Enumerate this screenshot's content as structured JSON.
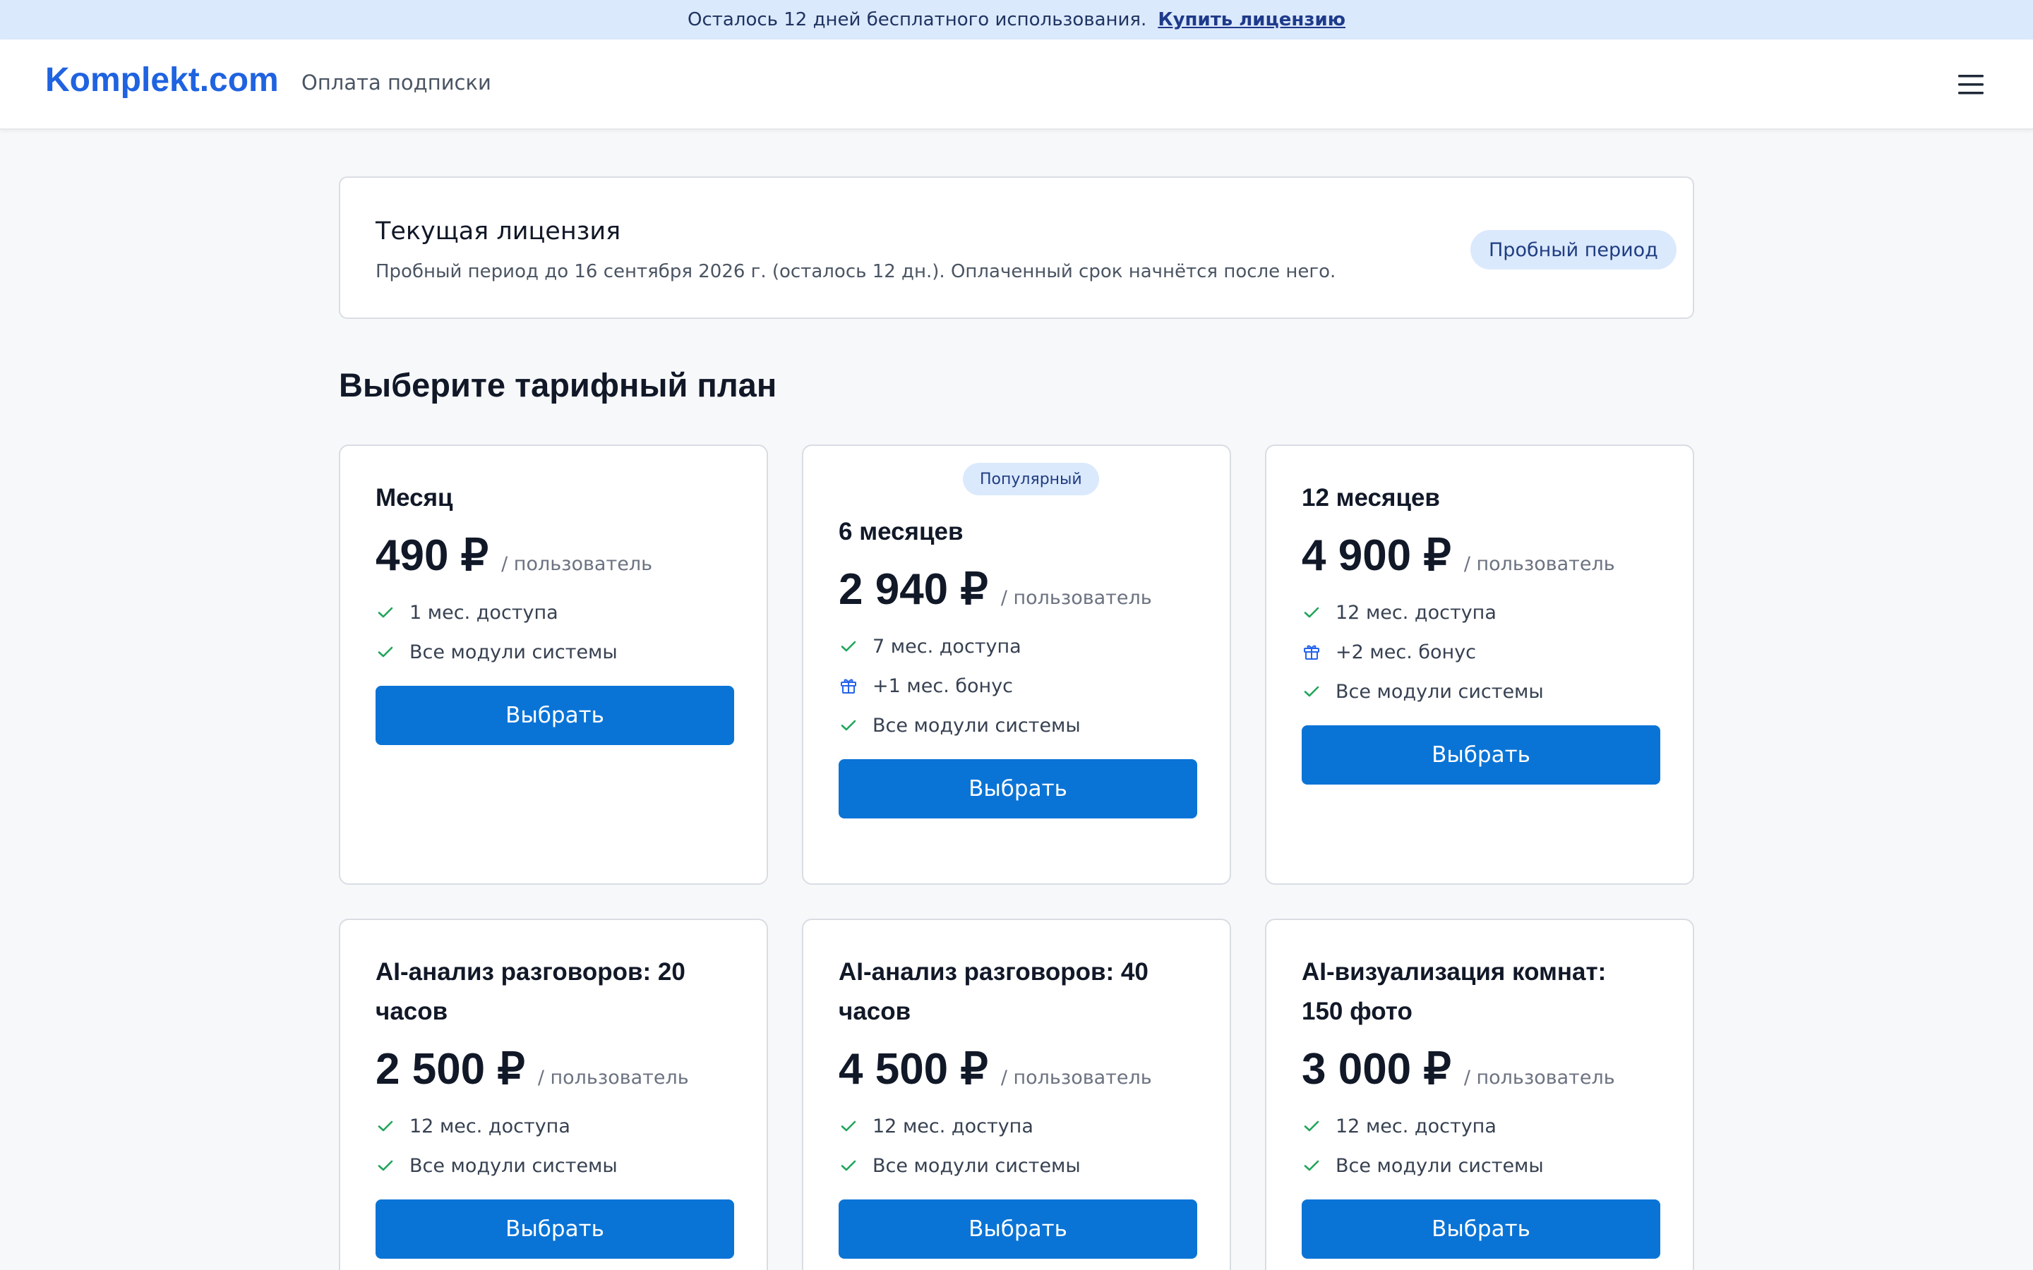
{
  "banner": {
    "text": "Осталось 12 дней бесплатного использования.",
    "link": "Купить лицензию"
  },
  "header": {
    "logo": "Komplekt.com",
    "subtitle": "Оплата подписки",
    "menu_icon": "hamburger-menu-icon"
  },
  "license": {
    "title": "Текущая лицензия",
    "description": "Пробный период до 16 сентября 2026 г. (осталось 12 дн.). Оплаченный срок начнётся после него.",
    "badge": "Пробный период"
  },
  "plans_section": {
    "title": "Выберите тарифный план"
  },
  "plans": [
    {
      "name": "Месяц",
      "price": "490 ₽",
      "per": "/ пользователь",
      "features": [
        {
          "icon": "check-icon",
          "text": "1 мес. доступа"
        },
        {
          "icon": "check-icon",
          "text": "Все модули системы"
        }
      ],
      "button": "Выбрать"
    },
    {
      "name": "6 месяцев",
      "badge": "Популярный",
      "price": "2 940 ₽",
      "per": "/ пользователь",
      "features": [
        {
          "icon": "check-icon",
          "text": "7 мес. доступа"
        },
        {
          "icon": "gift-icon",
          "text": "+1 мес. бонус"
        },
        {
          "icon": "check-icon",
          "text": "Все модули системы"
        }
      ],
      "button": "Выбрать"
    },
    {
      "name": "12 месяцев",
      "price": "4 900 ₽",
      "per": "/ пользователь",
      "features": [
        {
          "icon": "check-icon",
          "text": "12 мес. доступа"
        },
        {
          "icon": "gift-icon",
          "text": "+2 мес. бонус"
        },
        {
          "icon": "check-icon",
          "text": "Все модули системы"
        }
      ],
      "button": "Выбрать"
    },
    {
      "name_line1": "AI-анализ разговоров: 20",
      "name_line2": "часов",
      "price": "2 500 ₽",
      "per": "/ пользователь",
      "features": [
        {
          "icon": "check-icon",
          "text": "12 мес. доступа"
        },
        {
          "icon": "check-icon",
          "text": "Все модули системы"
        }
      ],
      "button": "Выбрать"
    },
    {
      "name_line1": "AI-анализ разговоров: 40",
      "name_line2": "часов",
      "price": "4 500 ₽",
      "per": "/ пользователь",
      "features": [
        {
          "icon": "check-icon",
          "text": "12 мес. доступа"
        },
        {
          "icon": "check-icon",
          "text": "Все модули системы"
        }
      ],
      "button": "Выбрать"
    },
    {
      "name_line1": "AI-визуализация комнат:",
      "name_line2": "150 фото",
      "price": "3 000 ₽",
      "per": "/ пользователь",
      "features": [
        {
          "icon": "check-icon",
          "text": "12 мес. доступа"
        },
        {
          "icon": "check-icon",
          "text": "Все модули системы"
        }
      ],
      "button": "Выбрать"
    }
  ],
  "colors": {
    "accent": "#0a74d6",
    "logo": "#1f63e0",
    "banner_bg": "#dbe9fd",
    "check": "#22a55b",
    "gift": "#2563eb"
  }
}
